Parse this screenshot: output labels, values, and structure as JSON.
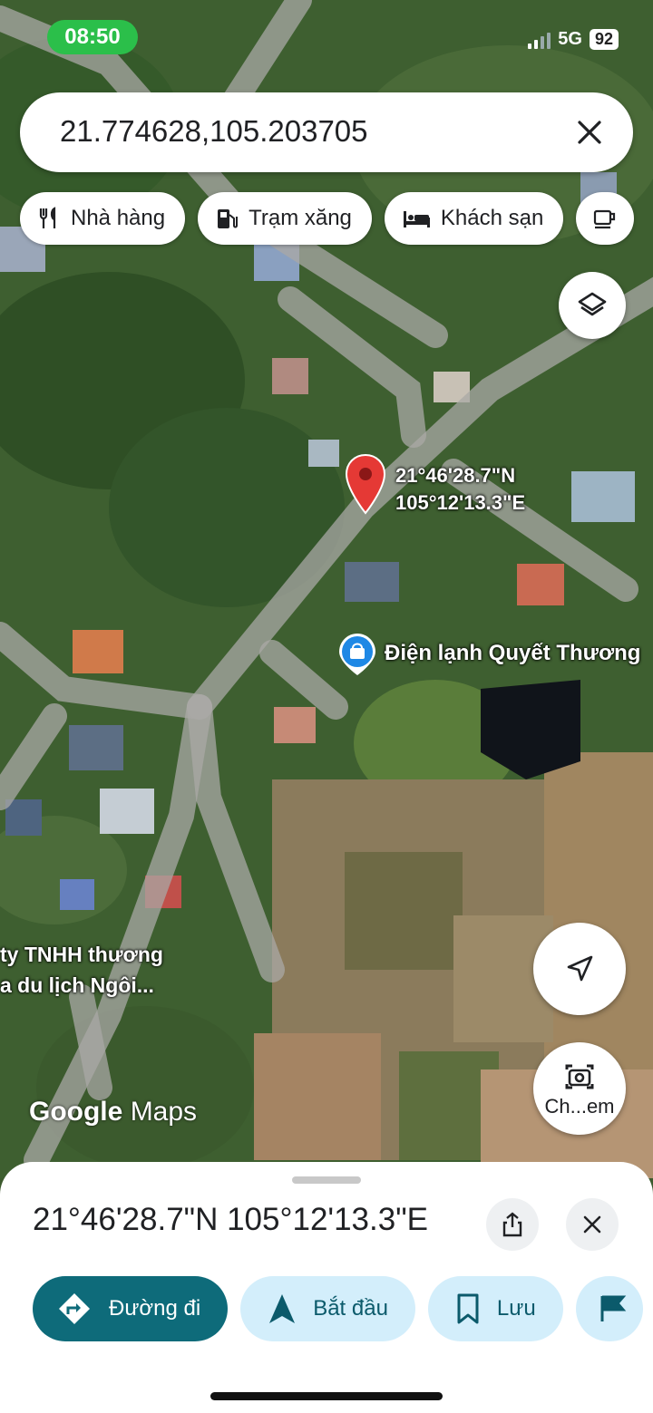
{
  "status_bar": {
    "time": "08:50",
    "network": "5G",
    "battery": "92"
  },
  "search": {
    "query": "21.774628,105.203705"
  },
  "chips": [
    {
      "label": "Nhà hàng",
      "icon": "restaurant-icon"
    },
    {
      "label": "Trạm xăng",
      "icon": "gas-station-icon"
    },
    {
      "label": "Khách sạn",
      "icon": "hotel-icon"
    },
    {
      "label": "",
      "icon": "cafe-icon"
    }
  ],
  "map": {
    "pin_label_line1": "21°46'28.7\"N",
    "pin_label_line2": "105°12'13.3\"E",
    "poi_name": "Điện lạnh Quyết Thương",
    "poi2_line1": "ty TNHH thương",
    "poi2_line2": "a du lịch Ngôi...",
    "logo_google": "Google",
    "logo_maps": "Maps",
    "lens_label": "Ch...em"
  },
  "sheet": {
    "title": "21°46'28.7\"N 105°12'13.3\"E",
    "actions": [
      {
        "label": "Đường đi",
        "icon": "directions-icon"
      },
      {
        "label": "Bắt đầu",
        "icon": "navigation-icon"
      },
      {
        "label": "Lưu",
        "icon": "bookmark-icon"
      }
    ]
  },
  "colors": {
    "primary_action": "#0e6b7a",
    "action_bg": "#d3eefb",
    "pin": "#e53935",
    "status_time_bg": "#2bbf4a"
  }
}
